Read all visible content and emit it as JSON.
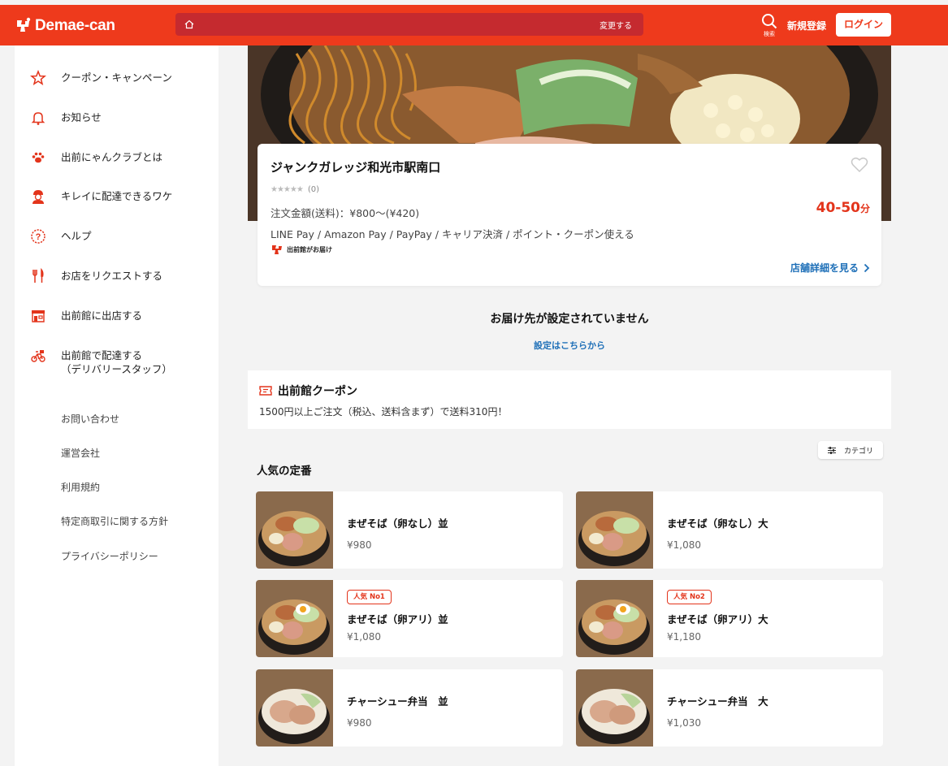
{
  "brand": {
    "name": "Demae-can",
    "accent": "#ee3a1c",
    "link_color": "#1f70b8"
  },
  "header": {
    "address_change": "変更する",
    "search_label": "検索",
    "signup": "新規登録",
    "login": "ログイン"
  },
  "sidebar": {
    "items": [
      {
        "label": "クーポン・キャンペーン",
        "icon": "star-icon"
      },
      {
        "label": "お知らせ",
        "icon": "bell-icon"
      },
      {
        "label": "出前にゃんクラブとは",
        "icon": "paw-icon"
      },
      {
        "label": "キレイに配達できるワケ",
        "icon": "delivery-staff-icon"
      },
      {
        "label": "ヘルプ",
        "icon": "help-icon"
      },
      {
        "label": "お店をリクエストする",
        "icon": "fork-knife-icon"
      },
      {
        "label": "出前館に出店する",
        "icon": "storefront-icon"
      },
      {
        "label": "出前館で配達する",
        "label2": "（デリバリースタッフ）",
        "icon": "bicycle-icon"
      }
    ],
    "links": [
      "お問い合わせ",
      "運営会社",
      "利用規約",
      "特定商取引に関する方針",
      "プライバシーポリシー"
    ]
  },
  "shop": {
    "name": "ジャンクガレッジ和光市駅南口",
    "stars": "★★★★★",
    "rating_count": "(0)",
    "min_order": "注文金額(送料)：¥800〜(¥420)",
    "eta_value": "40-50",
    "eta_unit": "分",
    "payments": "LINE Pay / Amazon Pay / PayPay / キャリア決済 / ポイント・クーポン使える",
    "delivery_by": "出前館がお届け",
    "detail_link": "店舗詳細を見る"
  },
  "address_notice": {
    "title": "お届け先が設定されていません",
    "link": "設定はこちらから"
  },
  "coupon": {
    "title": "出前館クーポン",
    "description": "1500円以上ご注文（税込、送料含まず）で送料310円！"
  },
  "category_button": "カテゴリ",
  "section_title": "人気の定番",
  "menu": [
    {
      "name": "まぜそば（卵なし）並",
      "price": "¥980",
      "badge": "",
      "image": "mazesoba-photo"
    },
    {
      "name": "まぜそば（卵なし）大",
      "price": "¥1,080",
      "badge": "",
      "image": "mazesoba-photo"
    },
    {
      "name": "まぜそば（卵アリ）並",
      "price": "¥1,080",
      "badge": "人気 No1",
      "image": "mazesoba-egg-photo"
    },
    {
      "name": "まぜそば（卵アリ）大",
      "price": "¥1,180",
      "badge": "人気 No2",
      "image": "mazesoba-egg-photo"
    },
    {
      "name": "チャーシュー弁当　並",
      "price": "¥980",
      "badge": "",
      "image": "chashu-bento-photo"
    },
    {
      "name": "チャーシュー弁当　大",
      "price": "¥1,030",
      "badge": "",
      "image": "chashu-bento-photo"
    }
  ]
}
